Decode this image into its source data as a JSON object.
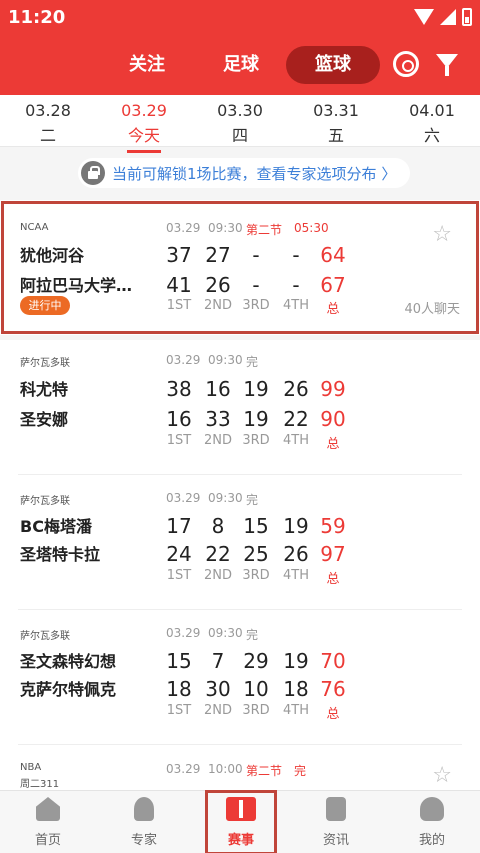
{
  "status": {
    "time": "11:20"
  },
  "nav": {
    "tabs": [
      "关注",
      "足球",
      "篮球"
    ]
  },
  "dates": [
    {
      "date": "03.28",
      "weekday": "二"
    },
    {
      "date": "03.29",
      "weekday": "今天"
    },
    {
      "date": "03.30",
      "weekday": "四"
    },
    {
      "date": "03.31",
      "weekday": "五"
    },
    {
      "date": "04.01",
      "weekday": "六"
    }
  ],
  "unlock_text": "当前可解锁1场比赛，查看专家选项分布 〉",
  "quarter_labels": [
    "1ST",
    "2ND",
    "3RD",
    "4TH",
    "总"
  ],
  "games": [
    {
      "league": "NCAA",
      "date": "03.29",
      "time": "09:30",
      "status": "第二节",
      "clock": "05:30",
      "home": {
        "name": "犹他河谷",
        "q": [
          "37",
          "27",
          "-",
          "-"
        ],
        "total": "64"
      },
      "away": {
        "name": "阿拉巴马大学…",
        "q": [
          "41",
          "26",
          "-",
          "-"
        ],
        "total": "67"
      },
      "badge": "进行中",
      "chat": "40人聊天"
    },
    {
      "league": "萨尔瓦多联",
      "date": "03.29",
      "time": "09:30",
      "status": "完",
      "home": {
        "name": "科尤特",
        "q": [
          "38",
          "16",
          "19",
          "26"
        ],
        "total": "99"
      },
      "away": {
        "name": "圣安娜",
        "q": [
          "16",
          "33",
          "19",
          "22"
        ],
        "total": "90"
      }
    },
    {
      "league": "萨尔瓦多联",
      "date": "03.29",
      "time": "09:30",
      "status": "完",
      "home": {
        "name": "BC梅塔潘",
        "q": [
          "17",
          "8",
          "15",
          "19"
        ],
        "total": "59"
      },
      "away": {
        "name": "圣塔特卡拉",
        "q": [
          "24",
          "22",
          "25",
          "26"
        ],
        "total": "97"
      }
    },
    {
      "league": "萨尔瓦多联",
      "date": "03.29",
      "time": "09:30",
      "status": "完",
      "home": {
        "name": "圣文森特幻想",
        "q": [
          "15",
          "7",
          "29",
          "19"
        ],
        "total": "70"
      },
      "away": {
        "name": "克萨尔特佩克",
        "q": [
          "18",
          "30",
          "10",
          "18"
        ],
        "total": "76"
      }
    }
  ],
  "partial": {
    "league": "NBA",
    "sub": "周二311",
    "date": "03.29",
    "time": "10:00",
    "status": "第二节",
    "clock": "完"
  },
  "tabs": [
    "首页",
    "专家",
    "赛事",
    "资讯",
    "我的"
  ]
}
